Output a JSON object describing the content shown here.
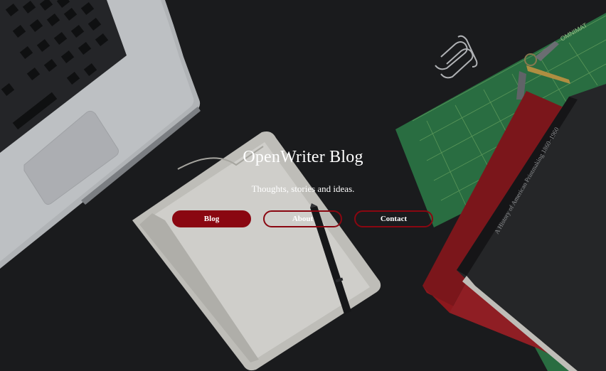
{
  "hero": {
    "title": "OpenWriter Blog",
    "tagline": "Thoughts, stories and ideas."
  },
  "nav": {
    "blog_label": "Blog",
    "about_label": "About",
    "contact_label": "Contact"
  },
  "colors": {
    "accent": "#8a0711",
    "background": "#1d1e20",
    "text": "#ffffff"
  }
}
